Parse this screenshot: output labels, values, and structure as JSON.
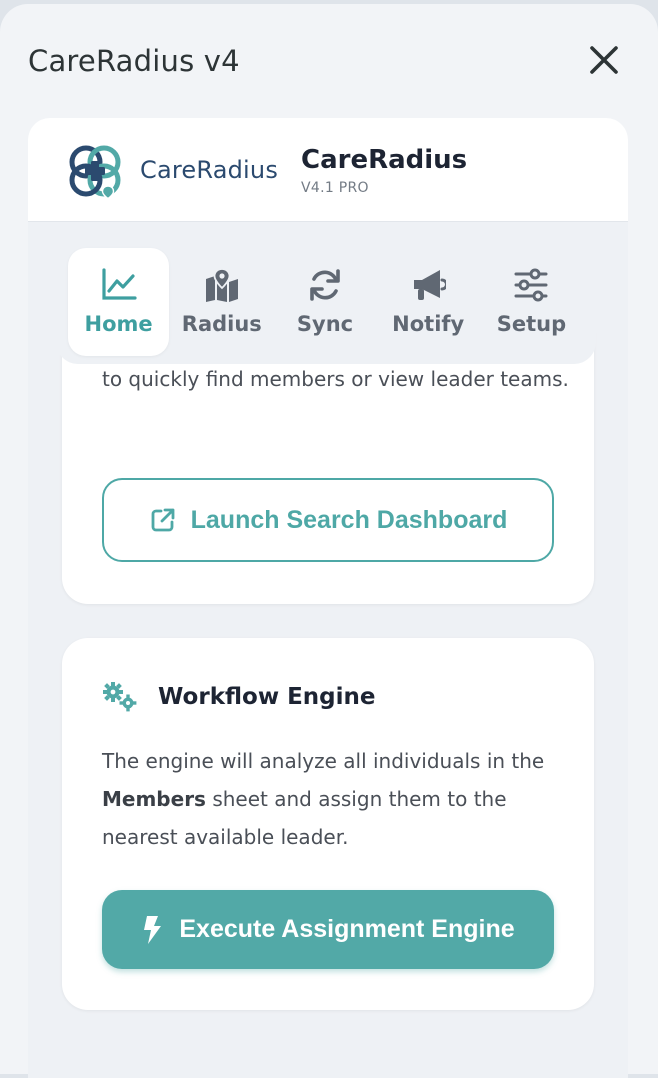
{
  "window": {
    "title": "CareRadius v4"
  },
  "brand": {
    "logo_text": "CareRadius",
    "name": "CareRadius",
    "version": "V4.1 PRO"
  },
  "nav": {
    "tabs": [
      {
        "label": "Home",
        "icon": "line-chart-icon",
        "active": true
      },
      {
        "label": "Radius",
        "icon": "map-icon",
        "active": false
      },
      {
        "label": "Sync",
        "icon": "sync-icon",
        "active": false
      },
      {
        "label": "Notify",
        "icon": "megaphone-icon",
        "active": false
      },
      {
        "label": "Setup",
        "icon": "sliders-icon",
        "active": false
      }
    ]
  },
  "search_card": {
    "text": "to quickly find members or view leader teams.",
    "button_label": "Launch Search Dashboard"
  },
  "workflow_card": {
    "title": "Workflow Engine",
    "text_before": "The engine will analyze all individuals in the ",
    "text_bold": "Members",
    "text_after": " sheet and assign them to the nearest available leader.",
    "button_label": "Execute Assignment Engine"
  },
  "colors": {
    "accent": "#52a9a7",
    "brand_blue": "#2b4a6f",
    "text": "#4a4f57"
  }
}
